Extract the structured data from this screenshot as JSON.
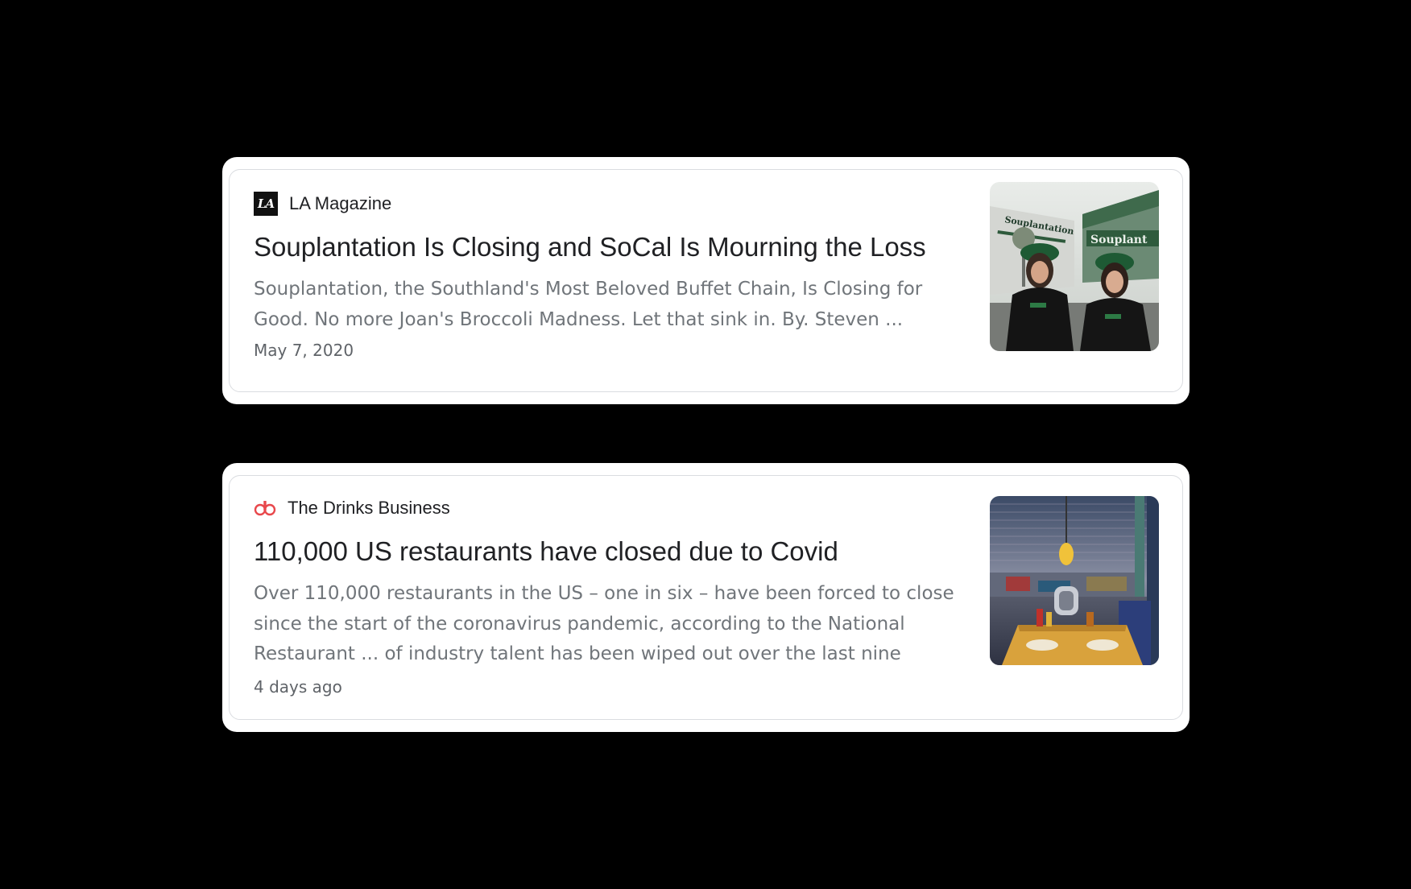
{
  "articles": [
    {
      "source": "LA Magazine",
      "source_logo_icon": "la-magazine-logo-icon",
      "source_logo_text": "LA",
      "headline": "Souplantation Is Closing and SoCal Is Mourning the Loss",
      "snippet": "Souplantation, the Southland's Most Beloved Buffet Chain, Is Closing for Good. No more Joan's Broccoli Madness. Let that sink in. By. Steven ...",
      "date": "May 7, 2020",
      "thumbnail_icon": "souplantation-storefront-photo",
      "thumbnail_sign_text": "Souplantation"
    },
    {
      "source": "The Drinks Business",
      "source_logo_icon": "drinks-business-logo-icon",
      "headline": "110,000 US restaurants have closed due to Covid",
      "snippet": "Over 110,000 restaurants in the US – one in six – have been forced to close since the start of the coronavirus pandemic, according to the National Restaurant ... of industry talent has been wiped out over the last nine",
      "date": "4 days ago",
      "thumbnail_icon": "diner-interior-photo"
    }
  ],
  "colors": {
    "background": "#000000",
    "card": "#ffffff",
    "card_border": "#dadce0",
    "headline": "#202124",
    "snippet": "#70757a",
    "date": "#5f6368",
    "drinks_business_logo": "#e8484c"
  }
}
